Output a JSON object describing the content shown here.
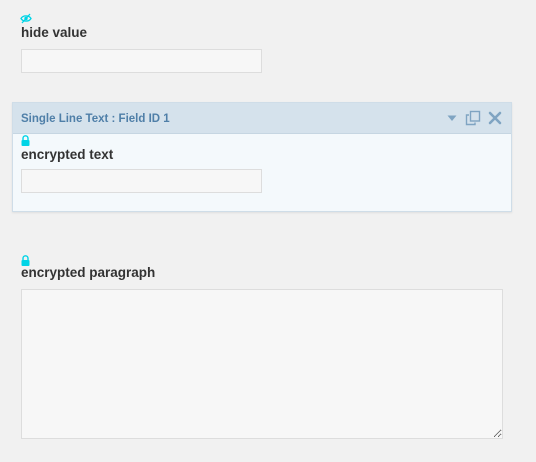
{
  "fields": [
    {
      "label": "hide value",
      "type": "text",
      "icon": "eye-icon",
      "value": ""
    },
    {
      "label": "encrypted text",
      "type": "text",
      "icon": "lock-icon",
      "value": ""
    },
    {
      "label": "encrypted paragraph",
      "type": "paragraph",
      "icon": "lock-icon",
      "value": ""
    }
  ],
  "active_field": {
    "title": "Single Line Text : Field ID 1",
    "actions": [
      "collapse-arrow-icon",
      "duplicate-icon",
      "delete-icon"
    ]
  },
  "colors": {
    "page_background": "#f1f1f1",
    "icon_accent": "#00d4e6",
    "panel_header": "#d5e2ec",
    "panel_title": "#4f7fa8",
    "panel_body": "#f4f9fc",
    "action_icons": "#7fa4c2"
  }
}
